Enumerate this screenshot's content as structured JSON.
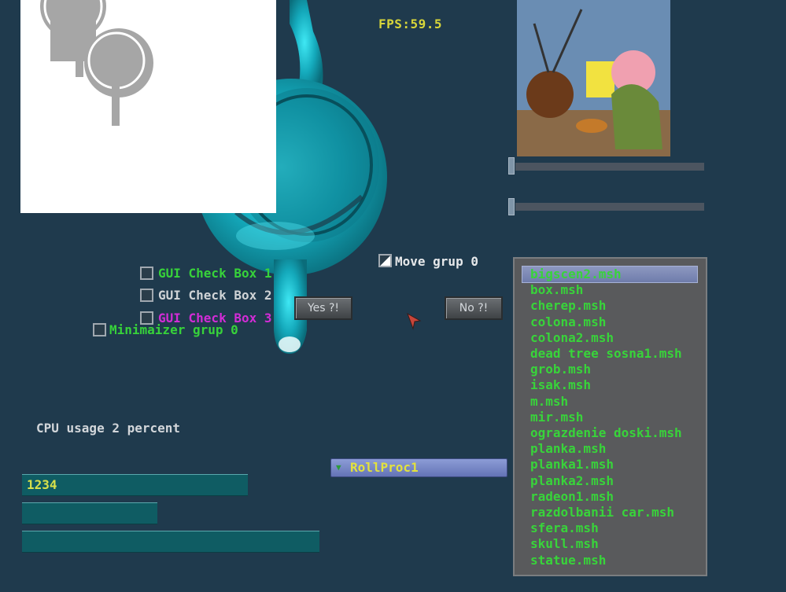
{
  "fps_label": "FPS:59.5",
  "checkboxes": [
    {
      "label": "GUI Check Box 1",
      "color": "#37d23a"
    },
    {
      "label": "GUI Check Box 2",
      "color": "#cfd3d6"
    },
    {
      "label": "GUI Check Box 3",
      "color": "#d22cd6"
    }
  ],
  "minimizer": {
    "label": "Minimaizer grup 0",
    "color": "#37d23a"
  },
  "move_group": {
    "label": "Move grup 0",
    "color": "#e6e8ea"
  },
  "buttons": {
    "yes": "Yes ?!",
    "no": "No ?!"
  },
  "cpu_usage": "CPU usage 2 percent",
  "fields": {
    "field1": "1234",
    "field2": "",
    "field3": ""
  },
  "combo": {
    "selected": "RollProc1"
  },
  "file_list": {
    "selected_index": 0,
    "items": [
      "bigscen2.msh",
      "box.msh",
      "cherep.msh",
      "colona.msh",
      "colona2.msh",
      "dead tree sosna1.msh",
      "grob.msh",
      "isak.msh",
      "m.msh",
      "mir.msh",
      "ograzdenie doski.msh",
      "planka.msh",
      "planka1.msh",
      "planka2.msh",
      "radeon1.msh",
      "razdolbanii car.msh",
      "sfera.msh",
      "skull.msh",
      "statue.msh"
    ]
  },
  "colors": {
    "background": "#1f3a4d",
    "teapot": "#17b7c9",
    "list_text": "#38d43a",
    "fps": "#d8d63a"
  }
}
